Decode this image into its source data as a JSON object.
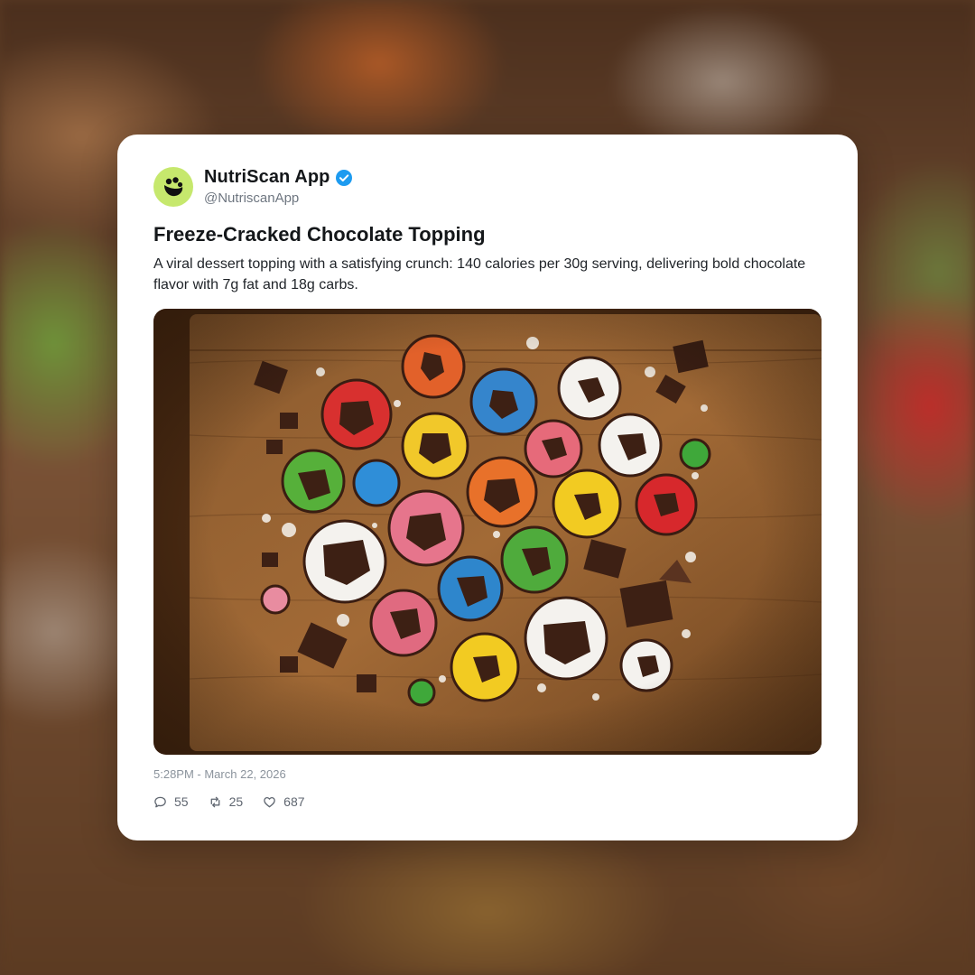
{
  "post": {
    "account_name": "NutriScan App",
    "handle": "@NutriscanApp",
    "title": "Freeze-Cracked Chocolate Topping",
    "description": "A viral dessert topping with a satisfying crunch: 140 calories per 30g serving, delivering bold chocolate flavor with 7g fat and 18g carbs.",
    "timestamp": "5:28PM - March 22, 2026",
    "stats": {
      "replies": "55",
      "reposts": "25",
      "likes": "687"
    }
  },
  "icons": {
    "avatar": "nutriscan-logo-icon",
    "verified": "verified-badge-icon",
    "reply": "reply-icon",
    "repost": "repost-icon",
    "like": "heart-icon"
  },
  "colors": {
    "avatar_bg": "#c6e86d",
    "verified_blue": "#1d9bf0",
    "card_bg": "#ffffff",
    "text_primary": "#14171a",
    "text_secondary": "#6e7680"
  }
}
